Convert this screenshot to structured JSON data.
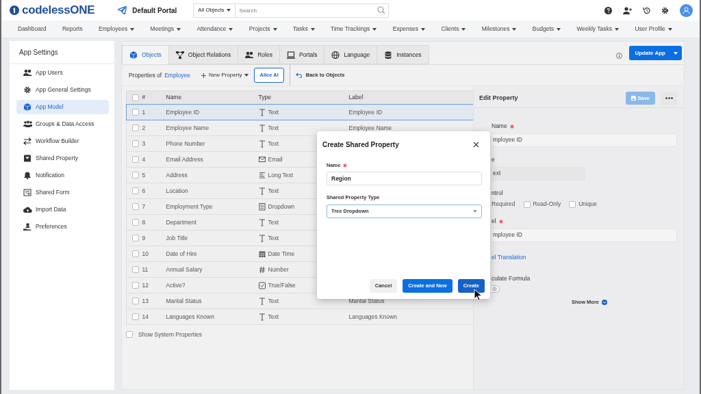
{
  "header": {
    "brand": "codelessONE",
    "portal": "Default Portal",
    "object_filter": "All Objects",
    "search": {
      "placeholder": "Search"
    }
  },
  "nav_menu": [
    {
      "label": "Dashboard",
      "dropdown": false
    },
    {
      "label": "Reports",
      "dropdown": false
    },
    {
      "label": "Employees",
      "dropdown": true
    },
    {
      "label": "Meetings",
      "dropdown": true
    },
    {
      "label": "Attendance",
      "dropdown": true
    },
    {
      "label": "Projects",
      "dropdown": true
    },
    {
      "label": "Tasks",
      "dropdown": true
    },
    {
      "label": "Time Trackings",
      "dropdown": true
    },
    {
      "label": "Expenses",
      "dropdown": true
    },
    {
      "label": "Clients",
      "dropdown": true
    },
    {
      "label": "Milestones",
      "dropdown": true
    },
    {
      "label": "Budgets",
      "dropdown": true
    },
    {
      "label": "Weekly Tasks",
      "dropdown": true
    },
    {
      "label": "User Profile",
      "dropdown": true
    }
  ],
  "sidebar": {
    "title": "App Settings",
    "items": [
      {
        "label": "App Users",
        "selected": false
      },
      {
        "label": "App General Settings",
        "selected": false
      },
      {
        "label": "App Model",
        "selected": true
      },
      {
        "label": "Groups & Data Access",
        "selected": false
      },
      {
        "label": "Workflow Builder",
        "selected": false
      },
      {
        "label": "Shared Property",
        "selected": false
      },
      {
        "label": "Notification",
        "selected": false
      },
      {
        "label": "Shared Form",
        "selected": false
      },
      {
        "label": "Import Data",
        "selected": false
      },
      {
        "label": "Preferences",
        "selected": false
      }
    ]
  },
  "tabs": [
    {
      "label": "Objects",
      "selected": true
    },
    {
      "label": "Object Relations",
      "selected": false
    },
    {
      "label": "Roles",
      "selected": false
    },
    {
      "label": "Portals",
      "selected": false
    },
    {
      "label": "Language",
      "selected": false
    },
    {
      "label": "Instances",
      "selected": false
    }
  ],
  "update_button": "Update App",
  "toolbar": {
    "prefix": "Properties of",
    "object": "Employee",
    "new_property": "New Property",
    "ai_button": "Alice AI",
    "back": "Back to Objects"
  },
  "table": {
    "select_all_checked": false,
    "columns": [
      "#",
      "Name",
      "Type",
      "Label"
    ],
    "rows": [
      {
        "selected": true,
        "checked": false,
        "number": "1",
        "name": "Employee ID",
        "kind": "text",
        "type": "Text",
        "label": "Employee ID"
      },
      {
        "selected": false,
        "checked": false,
        "number": "2",
        "name": "Employee Name",
        "kind": "text",
        "type": "Text",
        "label": "Employee Name"
      },
      {
        "selected": false,
        "checked": false,
        "number": "3",
        "name": "Phone Number",
        "kind": "text",
        "type": "Text"
      },
      {
        "selected": false,
        "checked": false,
        "number": "4",
        "name": "Email Address",
        "kind": "email",
        "type": "Email"
      },
      {
        "selected": false,
        "checked": false,
        "number": "5",
        "name": "Address",
        "kind": "longtext",
        "type": "Long Text"
      },
      {
        "selected": false,
        "checked": false,
        "number": "6",
        "name": "Location",
        "kind": "text",
        "type": "Text"
      },
      {
        "selected": false,
        "checked": false,
        "number": "7",
        "name": "Employment Type",
        "kind": "dropdown",
        "type": "Dropdown"
      },
      {
        "selected": false,
        "checked": false,
        "number": "8",
        "name": "Department",
        "kind": "text",
        "type": "Text"
      },
      {
        "selected": false,
        "checked": false,
        "number": "9",
        "name": "Job Title",
        "kind": "text",
        "type": "Text"
      },
      {
        "selected": false,
        "checked": false,
        "number": "10",
        "name": "Date of Hire",
        "kind": "datetime",
        "type": "Date Time"
      },
      {
        "selected": false,
        "checked": false,
        "number": "11",
        "name": "Annual Salary",
        "kind": "number",
        "type": "Number"
      },
      {
        "selected": false,
        "checked": false,
        "number": "12",
        "name": "Active?",
        "kind": "boolean",
        "type": "True/False"
      },
      {
        "selected": false,
        "checked": false,
        "number": "13",
        "name": "Marital Status",
        "kind": "text",
        "type": "Text",
        "label": "Marital Status"
      },
      {
        "selected": false,
        "checked": false,
        "number": "14",
        "name": "Languages Known",
        "kind": "text",
        "type": "Text",
        "label": "Languages Known"
      }
    ]
  },
  "show_system_properties": {
    "label": "Show System Properties",
    "checked": false
  },
  "edit_property": {
    "title": "Edit Property",
    "save": {
      "label": "Save",
      "disabled": true
    },
    "items": [
      {
        "kind": "field",
        "label": "Name",
        "required": true,
        "value": "mployee ID",
        "disabled": false
      },
      {
        "kind": "field",
        "label": "e",
        "required": false,
        "value": "ext",
        "disabled": true
      },
      {
        "kind": "options",
        "label": "ntrol",
        "options": [
          {
            "label": "Required"
          },
          {
            "label": "Read-Only",
            "checked": false
          },
          {
            "label": "Unique",
            "checked": false
          }
        ]
      },
      {
        "kind": "field",
        "label": "el",
        "required": true,
        "value": "mployee ID",
        "disabled": false
      },
      {
        "kind": "link",
        "label": "el Translation"
      },
      {
        "kind": "toggle",
        "label": "culate Formula",
        "on": false
      }
    ],
    "show_more": "Show More"
  },
  "modal": {
    "title": "Create Shared Property",
    "name_label": "Name",
    "name_required": true,
    "name_value": "Region",
    "type_label": "Shared Property Type",
    "type_value": "Tree Dropdown",
    "buttons": [
      {
        "label": "Cancel",
        "kind": "secondary"
      },
      {
        "label": "Create and New",
        "kind": "primary"
      },
      {
        "label": "Create",
        "kind": "primary-dark"
      }
    ]
  }
}
